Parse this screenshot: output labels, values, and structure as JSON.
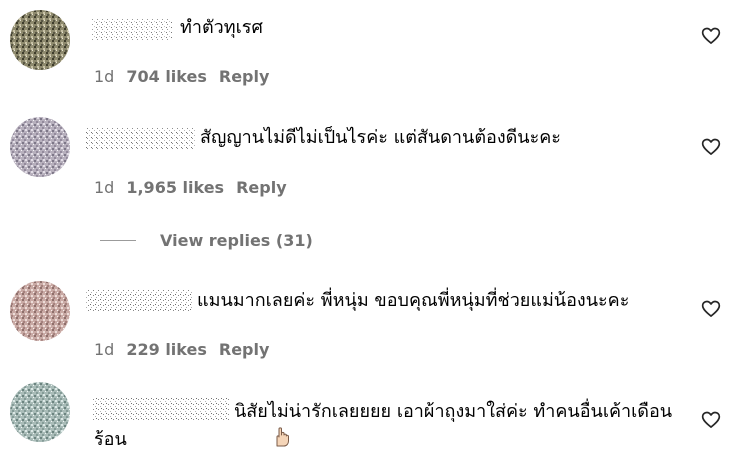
{
  "comments": [
    {
      "text": "ทำตัวทุเรศ",
      "time": "1d",
      "likes": "704 likes",
      "reply": "Reply"
    },
    {
      "text": "สัญญานไม่ดีไม่เป็นไรค่ะ แต่สันดานต้องดีนะคะ",
      "time": "1d",
      "likes": "1,965 likes",
      "reply": "Reply"
    },
    {
      "text": "แมนมากเลยค่ะ พี่หนุ่ม ขอบคุณพี่หนุ่มที่ช่วยแม่น้องนะคะ",
      "time": "1d",
      "likes": "229 likes",
      "reply": "Reply"
    },
    {
      "text": "นิสัยไม่น่ารักเลยยยย เอาผ้าถุงมาใส่ค่ะ ทำคนอื่นเค้าเดือนร้อน"
    }
  ],
  "view_replies": "View replies (31)",
  "icons": {
    "like": "heart-outline-icon",
    "emoji": "pointing-hand-emoji"
  },
  "colors": {
    "meta": "#737373",
    "text": "#000000"
  }
}
